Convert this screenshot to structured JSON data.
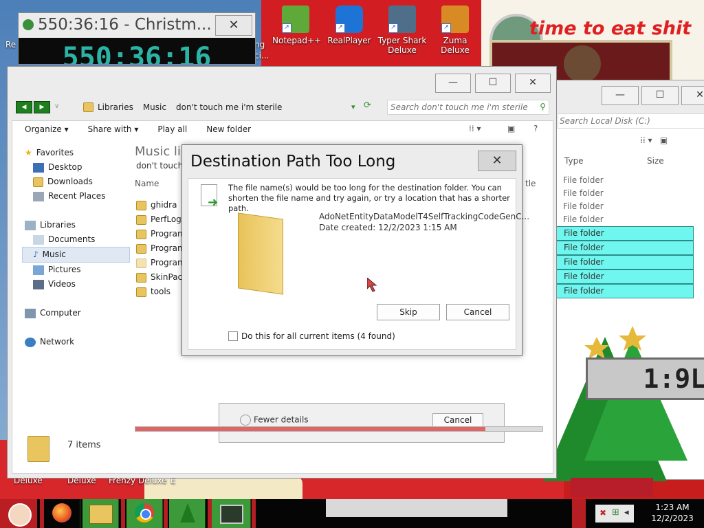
{
  "desktop": {
    "icons": [
      {
        "label": "Notepad++",
        "color": "#5fa83a",
        "icon": "notepad-plus-plus-icon"
      },
      {
        "label": "RealPlayer",
        "color": "#1e73d6",
        "icon": "realplayer-icon"
      },
      {
        "label": "Typer Shark Deluxe",
        "color": "#4f6e8a",
        "icon": "shark-icon"
      },
      {
        "label": "Zuma Deluxe",
        "color": "#d88a24",
        "icon": "zuma-icon"
      }
    ],
    "partial_left_label": "Re",
    "partial_label_2": "ng",
    "partial_label_3": "ci...",
    "bottom_labels": [
      "Deluxe",
      "Deluxe",
      "Frenzy Deluxe",
      "E"
    ],
    "banner_text": "time to eat shit"
  },
  "stopwatch": {
    "title": "550:36:16 - Christm...",
    "display": "550:36:16",
    "close_glyph": "✕"
  },
  "bg_window": {
    "search_placeholder": "Search Local Disk (C:)",
    "col_type": "Type",
    "col_size": "Size",
    "rows": [
      "File folder",
      "File folder",
      "File folder",
      "File folder",
      "File folder",
      "File folder",
      "File folder",
      "File folder",
      "File folder"
    ],
    "selected_from": 4
  },
  "explorer": {
    "breadcrumb": [
      "Libraries",
      "Music",
      "don't touch me i'm sterile"
    ],
    "search_placeholder": "Search don't touch me i'm sterile",
    "toolbar": {
      "organize": "Organize",
      "share_with": "Share with",
      "play_all": "Play all",
      "new_folder": "New folder"
    },
    "nav": {
      "favorites": "Favorites",
      "desktop": "Desktop",
      "downloads": "Downloads",
      "recent": "Recent Places",
      "libraries": "Libraries",
      "documents": "Documents",
      "music": "Music",
      "pictures": "Pictures",
      "videos": "Videos",
      "computer": "Computer",
      "network": "Network"
    },
    "lib_title": "Music lil",
    "lib_sub": "don't touch",
    "col_name": "Name",
    "col_title_partial": "tle",
    "files": [
      "ghidra",
      "PerfLogs",
      "Program",
      "Program",
      "Program",
      "SkinPack",
      "tools"
    ],
    "status": "7 items",
    "progress": 0.86
  },
  "copy_dialog": {
    "more_details": "Fewer details",
    "cancel": "Cancel"
  },
  "dialog": {
    "title": "Destination Path Too Long",
    "message": "The file name(s) would be too long for the destination folder.  You can shorten the file name and try again, or try a location that has a shorter path.",
    "filename": "AdoNetEntityDataModelT4SelfTrackingCodeGenC...",
    "date_created": "Date created: 12/2/2023 1:15 AM",
    "skip": "Skip",
    "cancel": "Cancel",
    "checkbox": "Do this for all current items (4 found)",
    "checkbox_checked": false
  },
  "taskbar": {
    "time": "1:23 AM",
    "date": "12/2/2023",
    "apps": [
      "santa-start-icon",
      "firefox-icon",
      "file-explorer-icon",
      "chrome-icon",
      "christmas-tree-icon",
      "terminal-icon"
    ]
  },
  "clock_widget": {
    "digits": "1:9L"
  }
}
